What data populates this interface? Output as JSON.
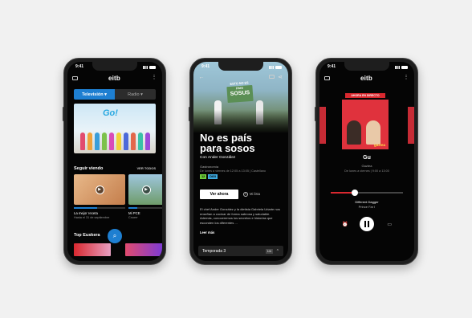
{
  "status": {
    "time": "9:41"
  },
  "phone1": {
    "logo": "eitb",
    "tabs": [
      {
        "label": "Televisión"
      },
      {
        "label": "Radio"
      }
    ],
    "hero_label": "Go!",
    "continue": {
      "title": "Seguir viendo",
      "more": "VER TODOS",
      "items": [
        {
          "title": "La mejor receta",
          "sub": "Hasta el 31 de septiembre",
          "progress": 0.45
        },
        {
          "title": "Mi PCE",
          "sub": "Cnoerr",
          "progress": 0.25
        }
      ]
    },
    "top": {
      "title": "Top Euskera"
    }
  },
  "phone2": {
    "sign_small": "ESTO NO ES PAIS",
    "sign": "SOSUS",
    "title_line1": "No es país",
    "title_line2": "para sosos",
    "host": "Con Ander González",
    "genre": "Gastronomía",
    "schedule": "De lunes a viernes de 12:05 a 13:05 | Castellano",
    "badges": [
      {
        "label": "12",
        "color": "#6fcf3b"
      },
      {
        "label": "DIGI",
        "color": "#3da9e0"
      }
    ],
    "watch_label": "Ver ahora",
    "mylist_label": "Mi lista",
    "description": "El chef Ander González y la dietista Gabriela Uriarte nos enseñan a cocinar de forma sabrosa y saludable. Además, conoceremos los secretos e historias que esconden los diferentes ...",
    "readmore": "Leer más",
    "season": "Temporada 3",
    "season_chip": "1/4"
  },
  "phone3": {
    "logo": "eitb",
    "live": "AHORA EN DIRECTO",
    "cover_text": "gaztea",
    "station": "Gu",
    "station_sub": "Gaztea",
    "schedule": "De lunes a viernes | 9:00 a 13:00",
    "progress": 0.33,
    "song": "Different Dagger",
    "artist": "Prince Far I"
  }
}
